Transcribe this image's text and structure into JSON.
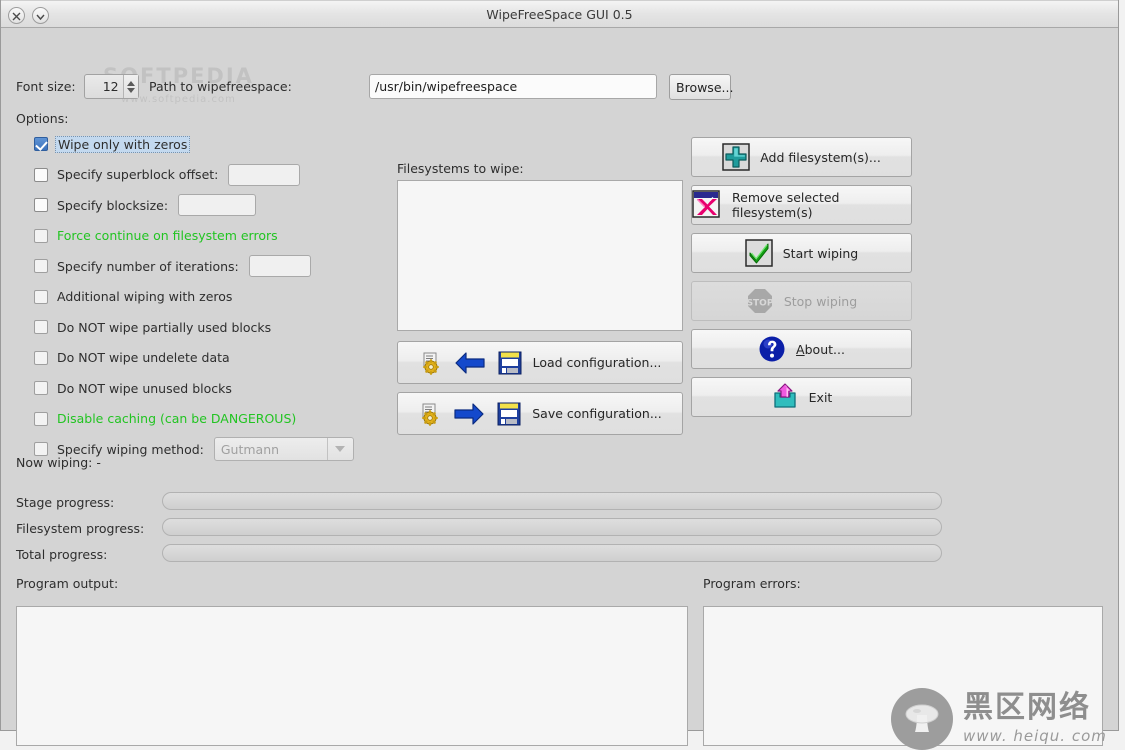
{
  "window": {
    "title": "WipeFreeSpace GUI 0.5",
    "close_icon": "close-icon",
    "minimize_icon": "chevron-down-icon"
  },
  "toolbar": {
    "font_size_label": "Font size:",
    "font_size_value": "12",
    "path_label": "Path to wipefreespace:",
    "path_value": "/usr/bin/wipefreespace",
    "path_placeholder": "/usr/bin/wipefreespace",
    "browse_label": "Browse..."
  },
  "options": {
    "section_label": "Options:",
    "items": [
      {
        "label": "Wipe only with zeros",
        "checked": true,
        "color": "normal",
        "focused": true,
        "field": null
      },
      {
        "label": "Specify superblock offset:",
        "checked": false,
        "color": "normal",
        "focused": false,
        "field": ""
      },
      {
        "label": "Specify blocksize:",
        "checked": false,
        "color": "normal",
        "focused": false,
        "field": ""
      },
      {
        "label": "Force continue on filesystem errors",
        "checked": false,
        "color": "green",
        "focused": false,
        "field": null
      },
      {
        "label": "Specify number of iterations:",
        "checked": false,
        "color": "normal",
        "focused": false,
        "field": ""
      },
      {
        "label": "Additional wiping with zeros",
        "checked": false,
        "color": "normal",
        "focused": false,
        "field": null
      },
      {
        "label": "Do NOT wipe partially used blocks",
        "checked": false,
        "color": "normal",
        "focused": false,
        "field": null
      },
      {
        "label": "Do NOT wipe undelete data",
        "checked": false,
        "color": "normal",
        "focused": false,
        "field": null
      },
      {
        "label": "Do NOT wipe unused blocks",
        "checked": false,
        "color": "normal",
        "focused": false,
        "field": null
      },
      {
        "label": "Disable caching (can be DANGEROUS)",
        "checked": false,
        "color": "green",
        "focused": false,
        "field": null
      },
      {
        "label": "Specify wiping method:",
        "checked": false,
        "color": "normal",
        "focused": false,
        "field": null
      }
    ],
    "wiping_method_selected": "Gutmann"
  },
  "filesystems": {
    "label": "Filesystems to wipe:",
    "entries": []
  },
  "config_buttons": {
    "load_label": "Load configuration...",
    "save_label": "Save configuration..."
  },
  "actions": {
    "add_label": "Add filesystem(s)...",
    "remove_label": "Remove selected filesystem(s)",
    "start_label": "Start wiping",
    "stop_label": "Stop wiping",
    "about_mnemonic": "A",
    "about_rest": "bout...",
    "exit_label": "Exit"
  },
  "progress": {
    "now_wiping_label": "Now wiping:",
    "now_wiping_value": "-",
    "stage_label": "Stage progress:",
    "stage_value": 0,
    "filesystem_label": "Filesystem progress:",
    "filesystem_value": 0,
    "total_label": "Total progress:",
    "total_value": 0
  },
  "output": {
    "program_output_label": "Program output:",
    "program_output_text": "",
    "program_errors_label": "Program errors:",
    "program_errors_text": ""
  },
  "watermarks": {
    "softpedia_main": "SOFTPEDIA",
    "softpedia_sub": "www.softpedia.com",
    "heiqu_cn": "黑区网络",
    "heiqu_url": "www. heiqu. com"
  },
  "colors": {
    "green_text": "#22c422",
    "focus_highlight": "#c3d9ef",
    "window_bg": "#d4d4d4"
  }
}
